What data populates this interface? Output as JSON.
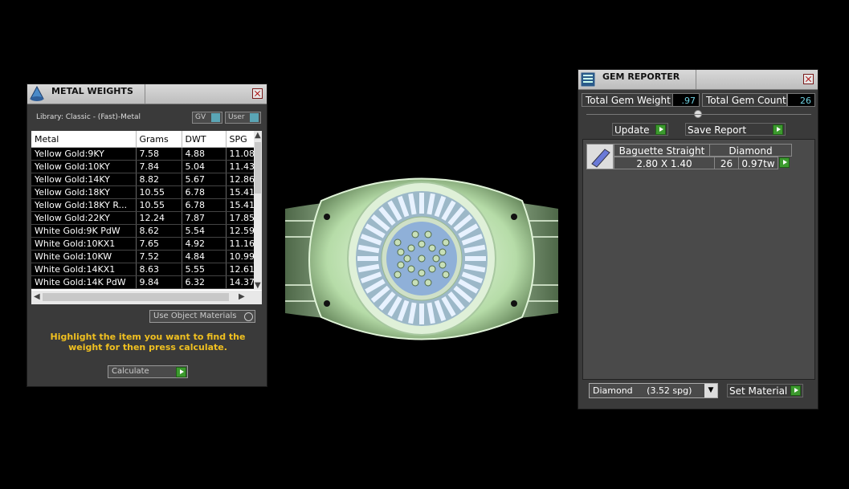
{
  "metal_weights": {
    "title": "METAL WEIGHTS",
    "library": "Library: Classic - (Fast)-Metal",
    "gv_label": "GV",
    "user_label": "User",
    "columns": [
      "Metal",
      "Grams",
      "DWT",
      "SPG"
    ],
    "rows": [
      [
        "Yellow Gold:9KY",
        "7.58",
        "4.88",
        "11.08"
      ],
      [
        "Yellow Gold:10KY",
        "7.84",
        "5.04",
        "11.43"
      ],
      [
        "Yellow Gold:14KY",
        "8.82",
        "5.67",
        "12.86"
      ],
      [
        "Yellow Gold:18KY",
        "10.55",
        "6.78",
        "15.41"
      ],
      [
        "Yellow Gold:18KY R...",
        "10.55",
        "6.78",
        "15.41"
      ],
      [
        "Yellow Gold:22KY",
        "12.24",
        "7.87",
        "17.85"
      ],
      [
        "White Gold:9K PdW",
        "8.62",
        "5.54",
        "12.59"
      ],
      [
        "White Gold:10KX1",
        "7.65",
        "4.92",
        "11.16"
      ],
      [
        "White Gold:10KW",
        "7.52",
        "4.84",
        "10.99"
      ],
      [
        "White Gold:14KX1",
        "8.63",
        "5.55",
        "12.61"
      ],
      [
        "White Gold:14K PdW",
        "9.84",
        "6.32",
        "14.37"
      ]
    ],
    "use_object_materials": "Use Object Materials",
    "hint": "Highlight the item you want to find the weight for then press calculate.",
    "calculate_label": "Calculate"
  },
  "gem_reporter": {
    "title": "GEM REPORTER",
    "total_gem_weight_label": "Total Gem Weight",
    "total_gem_weight": ".97",
    "total_gem_count_label": "Total Gem Count",
    "total_gem_count": "26",
    "update_label": "Update",
    "save_report_label": "Save Report",
    "gems": [
      {
        "shape": "Baguette Straight",
        "material": "Diamond",
        "size": "2.80 X 1.40",
        "count": "26",
        "weight": "0.97tw"
      }
    ],
    "material_select": "Diamond     (3.52 spg)",
    "set_material_label": "Set Material"
  },
  "colors": {
    "accent_green": "#3c9a2e",
    "hint_yellow": "#f0c020",
    "value_cyan": "#6fd0e0"
  }
}
